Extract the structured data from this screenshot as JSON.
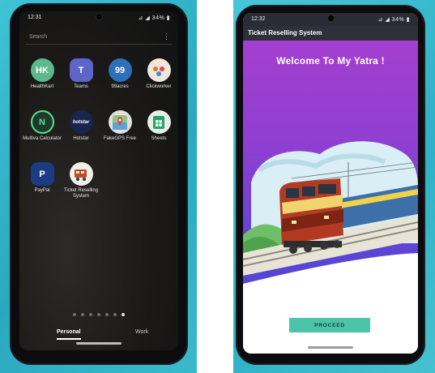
{
  "left_phone": {
    "status_time": "12:31",
    "status_icons": "⊿ ◢ 34% ▮",
    "search_label": "Search",
    "menu_glyph": "⋮",
    "apps": [
      {
        "name": "HealthKart",
        "icon_text": "HK",
        "icon_color": "#5cb98d"
      },
      {
        "name": "Teams",
        "icon_text": "T",
        "icon_color": "#5f64c8"
      },
      {
        "name": "99acres",
        "icon_text": "99",
        "icon_color": "#2d6fb8"
      },
      {
        "name": "Clickworker",
        "icon_text": "",
        "icon_color": "#f0e7da"
      },
      {
        "name": "Multiva Calculator",
        "icon_text": "N",
        "icon_color": "#1d3b2d"
      },
      {
        "name": "Hotstar",
        "icon_text": "hotstar",
        "icon_color": "#18254d"
      },
      {
        "name": "FakeGPS Free",
        "icon_text": "",
        "icon_color": "#e1e1e1"
      },
      {
        "name": "Sheets",
        "icon_text": "",
        "icon_color": "#e9ede9"
      },
      {
        "name": "PayPal",
        "icon_text": "P",
        "icon_color": "#1b3c84"
      },
      {
        "name": "Ticket Reselling System",
        "icon_text": "",
        "icon_color": "#f1f1ea"
      }
    ],
    "tabs": {
      "personal": "Personal",
      "work": "Work"
    }
  },
  "right_phone": {
    "status_time": "12:32",
    "status_icons": "⊿ ◢ 34% ▮",
    "app_title": "Ticket Reselling System",
    "welcome_text": "Welcome To My Yatra !",
    "proceed_label": "PROCEED",
    "accent_color": "#4cc4a9",
    "hero_gradient": [
      "#a43fd0",
      "#3f48d6"
    ]
  }
}
